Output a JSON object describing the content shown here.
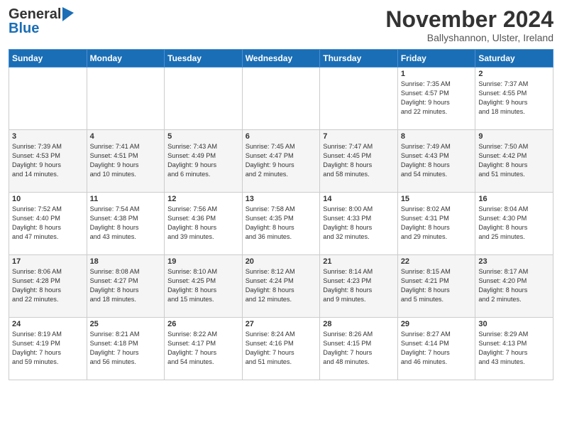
{
  "header": {
    "logo_general": "General",
    "logo_blue": "Blue",
    "month_title": "November 2024",
    "location": "Ballyshannon, Ulster, Ireland"
  },
  "weekdays": [
    "Sunday",
    "Monday",
    "Tuesday",
    "Wednesday",
    "Thursday",
    "Friday",
    "Saturday"
  ],
  "weeks": [
    [
      {
        "day": "",
        "info": ""
      },
      {
        "day": "",
        "info": ""
      },
      {
        "day": "",
        "info": ""
      },
      {
        "day": "",
        "info": ""
      },
      {
        "day": "",
        "info": ""
      },
      {
        "day": "1",
        "info": "Sunrise: 7:35 AM\nSunset: 4:57 PM\nDaylight: 9 hours\nand 22 minutes."
      },
      {
        "day": "2",
        "info": "Sunrise: 7:37 AM\nSunset: 4:55 PM\nDaylight: 9 hours\nand 18 minutes."
      }
    ],
    [
      {
        "day": "3",
        "info": "Sunrise: 7:39 AM\nSunset: 4:53 PM\nDaylight: 9 hours\nand 14 minutes."
      },
      {
        "day": "4",
        "info": "Sunrise: 7:41 AM\nSunset: 4:51 PM\nDaylight: 9 hours\nand 10 minutes."
      },
      {
        "day": "5",
        "info": "Sunrise: 7:43 AM\nSunset: 4:49 PM\nDaylight: 9 hours\nand 6 minutes."
      },
      {
        "day": "6",
        "info": "Sunrise: 7:45 AM\nSunset: 4:47 PM\nDaylight: 9 hours\nand 2 minutes."
      },
      {
        "day": "7",
        "info": "Sunrise: 7:47 AM\nSunset: 4:45 PM\nDaylight: 8 hours\nand 58 minutes."
      },
      {
        "day": "8",
        "info": "Sunrise: 7:49 AM\nSunset: 4:43 PM\nDaylight: 8 hours\nand 54 minutes."
      },
      {
        "day": "9",
        "info": "Sunrise: 7:50 AM\nSunset: 4:42 PM\nDaylight: 8 hours\nand 51 minutes."
      }
    ],
    [
      {
        "day": "10",
        "info": "Sunrise: 7:52 AM\nSunset: 4:40 PM\nDaylight: 8 hours\nand 47 minutes."
      },
      {
        "day": "11",
        "info": "Sunrise: 7:54 AM\nSunset: 4:38 PM\nDaylight: 8 hours\nand 43 minutes."
      },
      {
        "day": "12",
        "info": "Sunrise: 7:56 AM\nSunset: 4:36 PM\nDaylight: 8 hours\nand 39 minutes."
      },
      {
        "day": "13",
        "info": "Sunrise: 7:58 AM\nSunset: 4:35 PM\nDaylight: 8 hours\nand 36 minutes."
      },
      {
        "day": "14",
        "info": "Sunrise: 8:00 AM\nSunset: 4:33 PM\nDaylight: 8 hours\nand 32 minutes."
      },
      {
        "day": "15",
        "info": "Sunrise: 8:02 AM\nSunset: 4:31 PM\nDaylight: 8 hours\nand 29 minutes."
      },
      {
        "day": "16",
        "info": "Sunrise: 8:04 AM\nSunset: 4:30 PM\nDaylight: 8 hours\nand 25 minutes."
      }
    ],
    [
      {
        "day": "17",
        "info": "Sunrise: 8:06 AM\nSunset: 4:28 PM\nDaylight: 8 hours\nand 22 minutes."
      },
      {
        "day": "18",
        "info": "Sunrise: 8:08 AM\nSunset: 4:27 PM\nDaylight: 8 hours\nand 18 minutes."
      },
      {
        "day": "19",
        "info": "Sunrise: 8:10 AM\nSunset: 4:25 PM\nDaylight: 8 hours\nand 15 minutes."
      },
      {
        "day": "20",
        "info": "Sunrise: 8:12 AM\nSunset: 4:24 PM\nDaylight: 8 hours\nand 12 minutes."
      },
      {
        "day": "21",
        "info": "Sunrise: 8:14 AM\nSunset: 4:23 PM\nDaylight: 8 hours\nand 9 minutes."
      },
      {
        "day": "22",
        "info": "Sunrise: 8:15 AM\nSunset: 4:21 PM\nDaylight: 8 hours\nand 5 minutes."
      },
      {
        "day": "23",
        "info": "Sunrise: 8:17 AM\nSunset: 4:20 PM\nDaylight: 8 hours\nand 2 minutes."
      }
    ],
    [
      {
        "day": "24",
        "info": "Sunrise: 8:19 AM\nSunset: 4:19 PM\nDaylight: 7 hours\nand 59 minutes."
      },
      {
        "day": "25",
        "info": "Sunrise: 8:21 AM\nSunset: 4:18 PM\nDaylight: 7 hours\nand 56 minutes."
      },
      {
        "day": "26",
        "info": "Sunrise: 8:22 AM\nSunset: 4:17 PM\nDaylight: 7 hours\nand 54 minutes."
      },
      {
        "day": "27",
        "info": "Sunrise: 8:24 AM\nSunset: 4:16 PM\nDaylight: 7 hours\nand 51 minutes."
      },
      {
        "day": "28",
        "info": "Sunrise: 8:26 AM\nSunset: 4:15 PM\nDaylight: 7 hours\nand 48 minutes."
      },
      {
        "day": "29",
        "info": "Sunrise: 8:27 AM\nSunset: 4:14 PM\nDaylight: 7 hours\nand 46 minutes."
      },
      {
        "day": "30",
        "info": "Sunrise: 8:29 AM\nSunset: 4:13 PM\nDaylight: 7 hours\nand 43 minutes."
      }
    ]
  ]
}
